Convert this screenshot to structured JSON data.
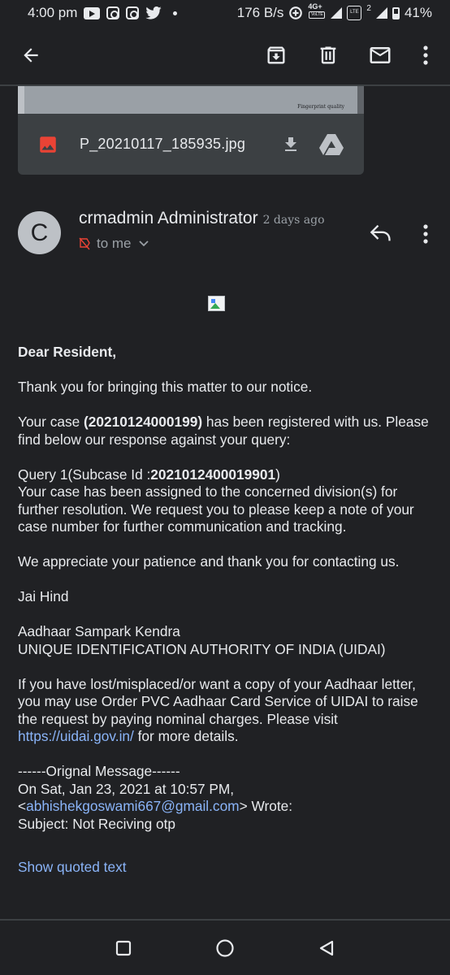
{
  "status_bar": {
    "time": "4:00 pm",
    "net_speed": "176 B/s",
    "network_label": "4G+",
    "sim2_label": "2",
    "battery": "41%"
  },
  "attachment": {
    "preview_caption": "Fingerprint quality",
    "filename": "P_20210117_185935.jpg"
  },
  "sender": {
    "avatar_letter": "C",
    "name": "crmadmin Administrator",
    "time": "2 days ago",
    "recipient": "to me"
  },
  "body": {
    "greeting": "Dear Resident,",
    "thanks": "Thank you for bringing this matter to our notice.",
    "case_prefix": "Your case ",
    "case_number": "(20210124000199)",
    "case_suffix": " has been registered with us. Please find below our response against your query:",
    "query_prefix": "Query 1(Subcase Id :",
    "subcase_id": "2021012400019901",
    "query_suffix": ")",
    "query_text": "Your case has been assigned to the concerned division(s) for further resolution. We request you to please keep a note of your case number for further communication and tracking.",
    "appreciate": "We appreciate your patience and thank you for contacting us.",
    "signoff": "Jai Hind",
    "org_line1": "Aadhaar Sampark Kendra",
    "org_line2": "UNIQUE IDENTIFICATION AUTHORITY OF INDIA (UIDAI)",
    "lost_text": "If you have lost/misplaced/or want a copy of your Aadhaar letter, you may use Order PVC Aadhaar Card Service of UIDAI to raise the request by paying nominal charges. Please visit ",
    "link_url": "https://uidai.gov.in/",
    "lost_suffix": " for more details.",
    "orig_header": "------Orignal Message------",
    "orig_date": "On Sat, Jan 23, 2021 at 10:57 PM,",
    "orig_from_open": "<",
    "orig_email": "abhishekgoswami667@gmail.com",
    "orig_from_close": "> Wrote:",
    "orig_subject": "Subject: Not Reciving otp"
  },
  "show_quoted_label": "Show quoted text",
  "colors": {
    "background": "#202124",
    "text": "#e8eaed",
    "link": "#8ab4f8",
    "attachment_icon": "#ea4335"
  },
  "icons": {
    "toolbar": [
      "back-arrow-icon",
      "archive-icon",
      "delete-icon",
      "mark-unread-icon",
      "more-vert-icon"
    ],
    "attachment": [
      "image-icon",
      "download-icon",
      "drive-icon"
    ],
    "sender": [
      "reply-icon",
      "more-vert-icon",
      "label-icon",
      "chevron-down-icon"
    ],
    "nav": [
      "recents-icon",
      "home-icon",
      "back-icon"
    ]
  }
}
